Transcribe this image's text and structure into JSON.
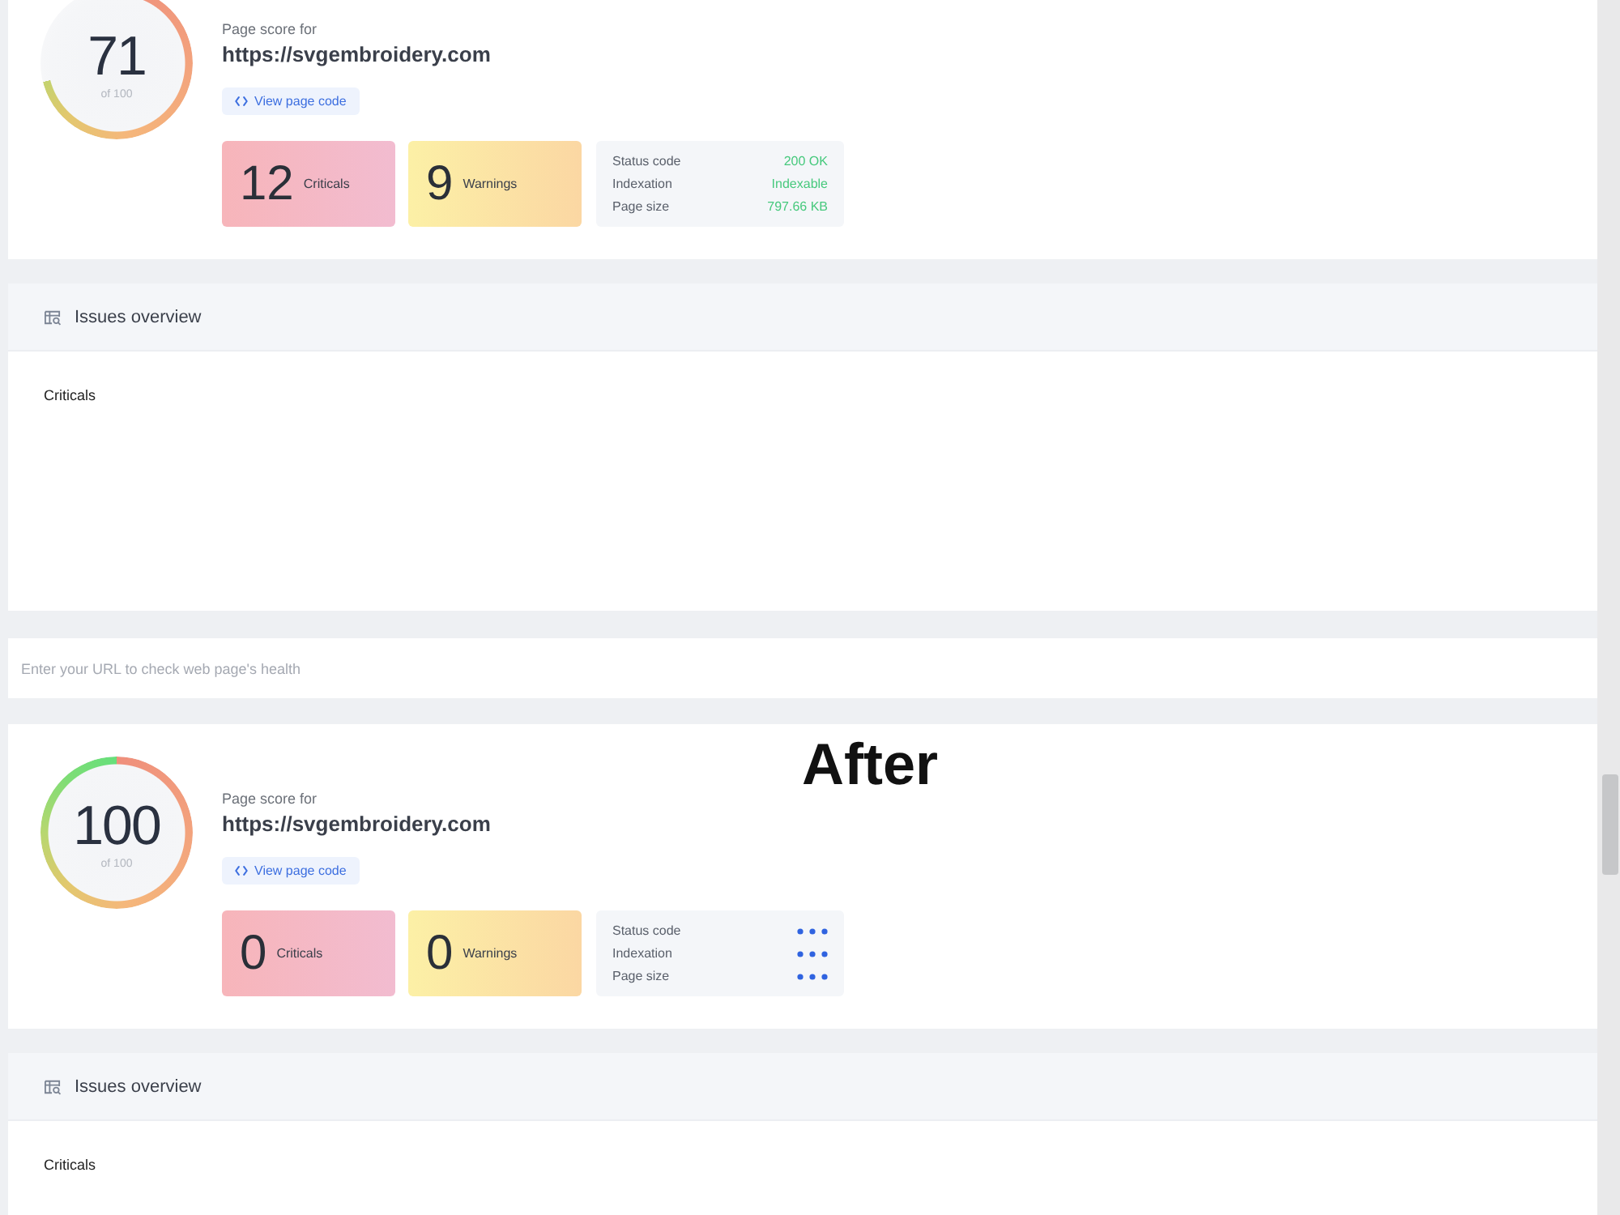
{
  "sections": [
    {
      "kind": "report",
      "score": "71",
      "score_caption": "of 100",
      "heading": "Page score for",
      "url": "https://svgembroidery.com",
      "code_button": "View page code",
      "counts": [
        {
          "kind": "criticals",
          "value": "12",
          "label": "Criticals"
        },
        {
          "kind": "warnings",
          "value": "9",
          "label": "Warnings"
        }
      ],
      "status": [
        {
          "label": "Status code",
          "kind": "text",
          "value": "200 OK"
        },
        {
          "label": "Indexation",
          "kind": "text",
          "value": "Indexable"
        },
        {
          "label": "Page size",
          "kind": "text",
          "value": "797.66 KB"
        }
      ],
      "issues": {
        "title": "Issues overview",
        "rows": [
          "Criticals"
        ]
      }
    },
    {
      "kind": "url_field",
      "placeholder": "Enter your URL to check web page's health"
    },
    {
      "kind": "report",
      "caption": "After",
      "score": "100",
      "score_caption": "of 100",
      "heading": "Page score for",
      "url": "https://svgembroidery.com",
      "code_button": "View page code",
      "counts": [
        {
          "kind": "criticals",
          "value": "0",
          "label": "Criticals"
        },
        {
          "kind": "warnings",
          "value": "0",
          "label": "Warnings"
        }
      ],
      "status": [
        {
          "label": "Status code",
          "kind": "loading"
        },
        {
          "label": "Indexation",
          "kind": "loading"
        },
        {
          "label": "Page size",
          "kind": "loading"
        }
      ],
      "issues": {
        "title": "Issues overview",
        "rows": [
          "Criticals"
        ]
      }
    }
  ]
}
